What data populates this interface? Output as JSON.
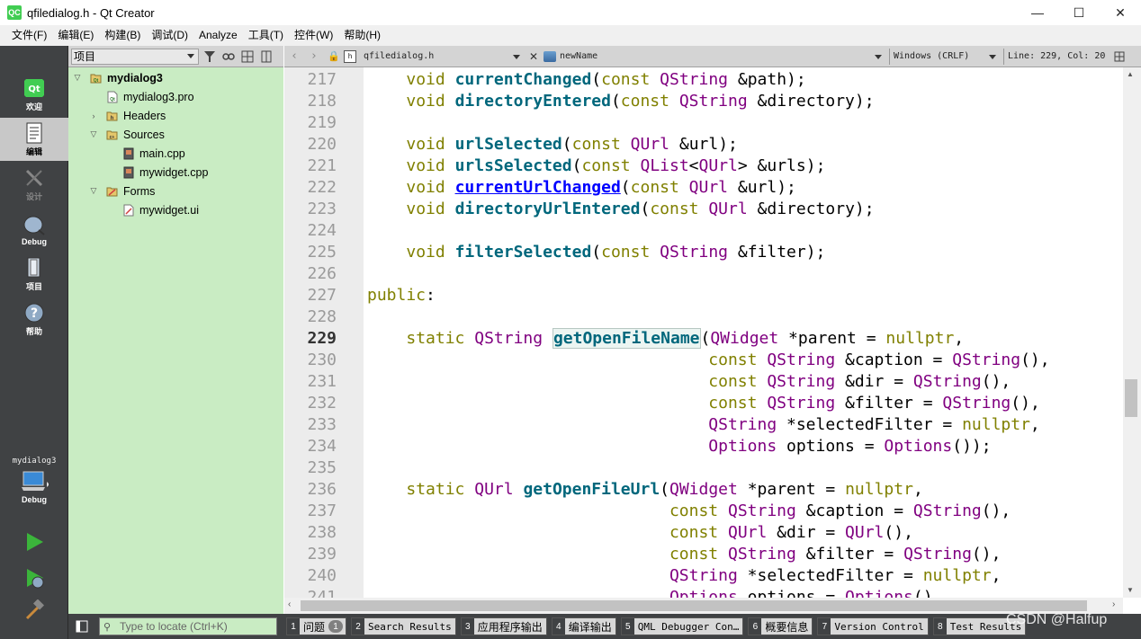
{
  "window": {
    "title": "qfiledialog.h - Qt Creator",
    "app_icon": "QC",
    "controls": {
      "minimize": "—",
      "maximize": "☐",
      "close": "✕"
    }
  },
  "menubar": [
    "文件(F)",
    "编辑(E)",
    "构建(B)",
    "调试(D)",
    "Analyze",
    "工具(T)",
    "控件(W)",
    "帮助(H)"
  ],
  "modes": [
    {
      "id": "welcome",
      "label": "欢迎",
      "icon": "qt-logo-icon"
    },
    {
      "id": "edit",
      "label": "编辑",
      "icon": "edit-document-icon",
      "active": true
    },
    {
      "id": "design",
      "label": "设计",
      "icon": "design-pen-icon",
      "disabled": true
    },
    {
      "id": "debug",
      "label": "Debug",
      "icon": "debug-bug-icon"
    },
    {
      "id": "projects",
      "label": "项目",
      "icon": "projects-icon"
    },
    {
      "id": "help",
      "label": "帮助",
      "icon": "help-icon"
    }
  ],
  "kit": {
    "project": "mydialog3",
    "config": "Debug"
  },
  "project_panel": {
    "view_select": "项目",
    "tree": [
      {
        "label": "mydialog3",
        "level": 0,
        "expanded": true,
        "icon": "project-icon",
        "bold": true
      },
      {
        "label": "mydialog3.pro",
        "level": 1,
        "icon": "pro-file-icon"
      },
      {
        "label": "Headers",
        "level": 1,
        "expanded": false,
        "icon": "headers-folder-icon"
      },
      {
        "label": "Sources",
        "level": 1,
        "expanded": true,
        "icon": "sources-folder-icon"
      },
      {
        "label": "main.cpp",
        "level": 2,
        "icon": "cpp-file-icon"
      },
      {
        "label": "mywidget.cpp",
        "level": 2,
        "icon": "cpp-file-icon"
      },
      {
        "label": "Forms",
        "level": 1,
        "expanded": true,
        "icon": "forms-folder-icon"
      },
      {
        "label": "mywidget.ui",
        "level": 2,
        "icon": "ui-file-icon"
      }
    ]
  },
  "editor_toolbar": {
    "document": "qfiledialog.h",
    "symbol": "newName",
    "line_endings": "Windows (CRLF)",
    "position": "Line: 229, Col: 20"
  },
  "editor": {
    "current_line": 229,
    "lines": [
      {
        "n": "217",
        "code": "    void currentChanged(const QString &path);"
      },
      {
        "n": "218",
        "code": "    void directoryEntered(const QString &directory);"
      },
      {
        "n": "219",
        "code": ""
      },
      {
        "n": "220",
        "code": "    void urlSelected(const QUrl &url);"
      },
      {
        "n": "221",
        "code": "    void urlsSelected(const QList<QUrl> &urls);"
      },
      {
        "n": "222",
        "code": "    void currentUrlChanged(const QUrl &url);"
      },
      {
        "n": "223",
        "code": "    void directoryUrlEntered(const QUrl &directory);"
      },
      {
        "n": "224",
        "code": ""
      },
      {
        "n": "225",
        "code": "    void filterSelected(const QString &filter);"
      },
      {
        "n": "226",
        "code": ""
      },
      {
        "n": "227",
        "code": "public:"
      },
      {
        "n": "228",
        "code": ""
      },
      {
        "n": "229",
        "code": "    static QString getOpenFileName(QWidget *parent = nullptr,"
      },
      {
        "n": "230",
        "code": "                                   const QString &caption = QString(),"
      },
      {
        "n": "231",
        "code": "                                   const QString &dir = QString(),"
      },
      {
        "n": "232",
        "code": "                                   const QString &filter = QString(),"
      },
      {
        "n": "233",
        "code": "                                   QString *selectedFilter = nullptr,"
      },
      {
        "n": "234",
        "code": "                                   Options options = Options());"
      },
      {
        "n": "235",
        "code": ""
      },
      {
        "n": "236",
        "code": "    static QUrl getOpenFileUrl(QWidget *parent = nullptr,"
      },
      {
        "n": "237",
        "code": "                               const QString &caption = QString(),"
      },
      {
        "n": "238",
        "code": "                               const QUrl &dir = QUrl(),"
      },
      {
        "n": "239",
        "code": "                               const QString &filter = QString(),"
      },
      {
        "n": "240",
        "code": "                               QString *selectedFilter = nullptr,"
      },
      {
        "n": "241",
        "code": "                               Options options = Options()"
      }
    ]
  },
  "statusbar": {
    "locator_placeholder": "Type to locate (Ctrl+K)",
    "tabs": [
      {
        "num": "1",
        "label": "问题",
        "badge": "1"
      },
      {
        "num": "2",
        "label": "Search Results"
      },
      {
        "num": "3",
        "label": "应用程序输出"
      },
      {
        "num": "4",
        "label": "编译输出"
      },
      {
        "num": "5",
        "label": "QML Debugger Con…"
      },
      {
        "num": "6",
        "label": "概要信息"
      },
      {
        "num": "7",
        "label": "Version Control"
      },
      {
        "num": "8",
        "label": "Test Results"
      }
    ]
  },
  "watermark": "CSDN @Halfup",
  "colors": {
    "keyword": "#808000",
    "type": "#800080",
    "function": "#00677c",
    "link": "#0000ff",
    "project_panel_bg": "#c9ecc3",
    "sidebar_bg": "#404244"
  }
}
